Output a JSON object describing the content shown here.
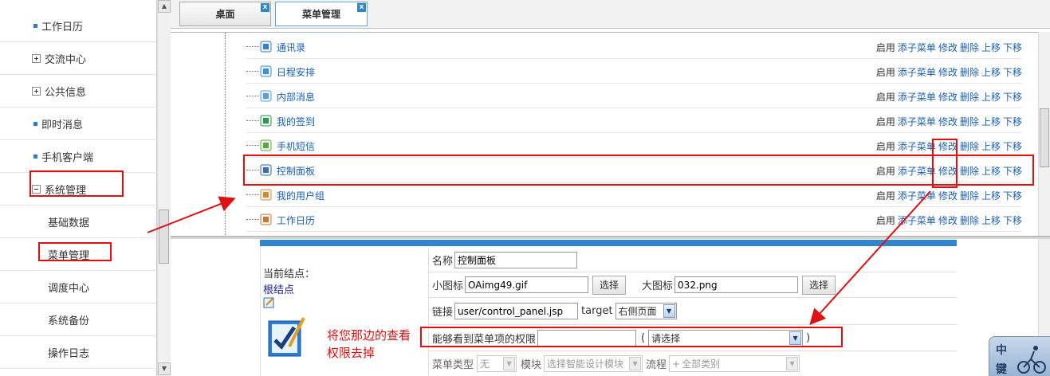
{
  "sidebar": {
    "items": [
      {
        "label": "工作日历",
        "kind": "bullet"
      },
      {
        "label": "交流中心",
        "kind": "expand"
      },
      {
        "label": "公共信息",
        "kind": "expand"
      },
      {
        "label": "即时消息",
        "kind": "bullet"
      },
      {
        "label": "手机客户端",
        "kind": "bullet"
      },
      {
        "label": "系统管理",
        "kind": "collapse"
      },
      {
        "label": "基础数据",
        "kind": "sub"
      },
      {
        "label": "菜单管理",
        "kind": "sub"
      },
      {
        "label": "调度中心",
        "kind": "sub"
      },
      {
        "label": "系统备份",
        "kind": "sub"
      },
      {
        "label": "操作日志",
        "kind": "sub"
      }
    ]
  },
  "tabs": [
    {
      "label": "桌面",
      "close": "x"
    },
    {
      "label": "菜单管理",
      "close": "x"
    }
  ],
  "tree": {
    "ops": {
      "enable": "启用",
      "add_child": "添子菜单",
      "edit": "修改",
      "delete": "删除",
      "up": "上移",
      "down": "下移"
    },
    "rows": [
      {
        "name": "通讯录",
        "icon": "address-book-icon"
      },
      {
        "name": "日程安排",
        "icon": "calendar-icon"
      },
      {
        "name": "内部消息",
        "icon": "message-icon"
      },
      {
        "name": "我的签到",
        "icon": "sign-in-icon"
      },
      {
        "name": "手机短信",
        "icon": "sms-icon"
      },
      {
        "name": "控制面板",
        "icon": "control-panel-icon"
      },
      {
        "name": "我的用户组",
        "icon": "user-group-icon"
      },
      {
        "name": "工作日历",
        "icon": "work-calendar-icon"
      }
    ]
  },
  "form": {
    "current_node_label": "当前结点：",
    "root_node_link": "根结点",
    "name_label": "名称",
    "name_value": "控制面板",
    "small_icon_label": "小图标",
    "small_icon_value": "OAimg49.gif",
    "choose_label": "选择",
    "big_icon_label": "大图标",
    "big_icon_value": "032.png",
    "link_label": "链接",
    "link_value": "user/control_panel.jsp",
    "target_label": "target",
    "target_value": "右侧页面",
    "permission_label": "能够看到菜单项的权限",
    "permission_value": "",
    "open_paren": "(",
    "close_paren": ")",
    "permission_select": "请选择",
    "menu_type_label": "菜单类型",
    "menu_type_value": "无",
    "module_label": "模块",
    "module_value": "选择智能设计模块",
    "flow_label": "流程",
    "flow_value": "全部类别"
  },
  "annotation": {
    "note_line1": "将您那边的查看",
    "note_line2": "权限去掉",
    "color": "#e01010"
  },
  "badge": {
    "line1": "中",
    "line2": "键"
  },
  "colors": {
    "link": "#1a5fb4",
    "accent": "#2f86d0"
  }
}
